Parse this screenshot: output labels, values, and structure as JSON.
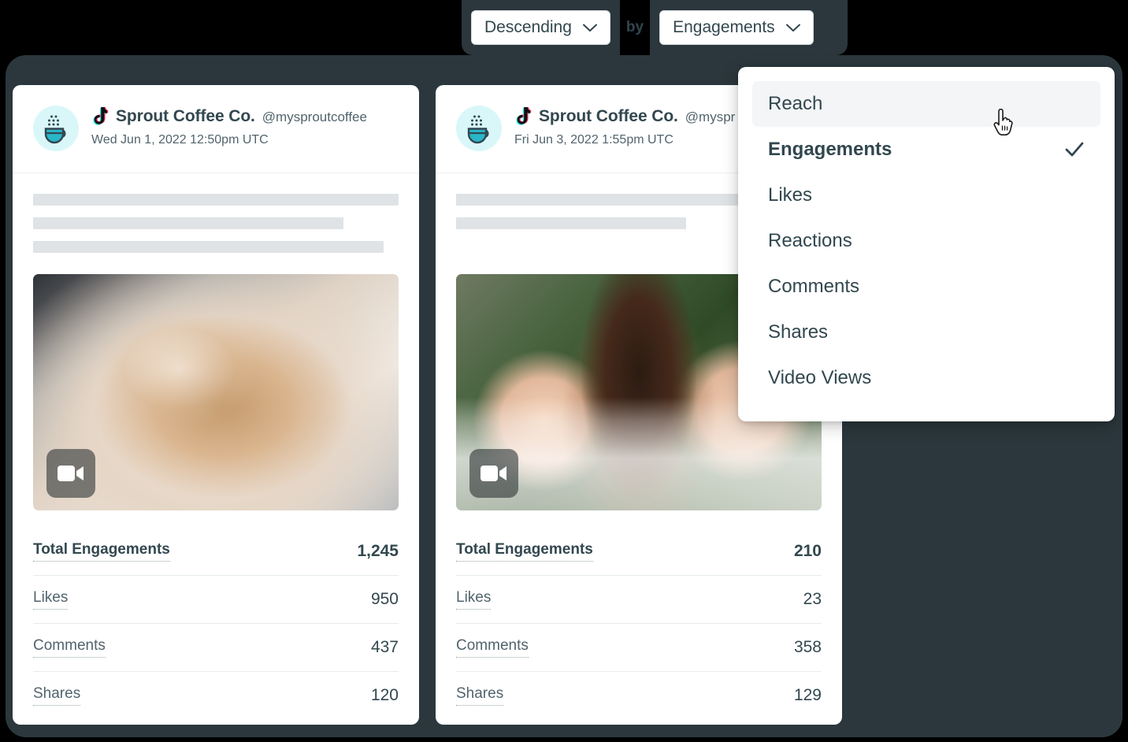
{
  "sort_bar": {
    "direction": {
      "value": "Descending",
      "icon": "chevron-down-icon"
    },
    "conjunction": "by",
    "metric": {
      "value": "Engagements",
      "icon": "chevron-down-icon"
    }
  },
  "dropdown": {
    "items": [
      {
        "label": "Reach",
        "selected": false,
        "hovered": true
      },
      {
        "label": "Engagements",
        "selected": true,
        "hovered": false
      },
      {
        "label": "Likes",
        "selected": false,
        "hovered": false
      },
      {
        "label": "Reactions",
        "selected": false,
        "hovered": false
      },
      {
        "label": "Comments",
        "selected": false,
        "hovered": false
      },
      {
        "label": "Shares",
        "selected": false,
        "hovered": false
      },
      {
        "label": "Video Views",
        "selected": false,
        "hovered": false
      }
    ]
  },
  "cards": [
    {
      "account_name": "Sprout Coffee Co.",
      "handle": "@mysproutcoffee",
      "date": "Wed Jun 1, 2022 12:50pm UTC",
      "network_icon": "tiktok-icon",
      "avatar_icon": "coffee-cup-icon",
      "media_badge_icon": "video-camera-icon",
      "media_alt": "iced latte in clear plastic cup",
      "metrics": [
        {
          "label": "Total Engagements",
          "value": "1,245",
          "total": true
        },
        {
          "label": "Likes",
          "value": "950",
          "total": false
        },
        {
          "label": "Comments",
          "value": "437",
          "total": false
        },
        {
          "label": "Shares",
          "value": "120",
          "total": false
        }
      ]
    },
    {
      "account_name": "Sprout Coffee Co.",
      "handle": "@myspr",
      "date": "Fri Jun 3, 2022 1:55pm UTC",
      "network_icon": "tiktok-icon",
      "avatar_icon": "coffee-cup-icon",
      "media_badge_icon": "video-camera-icon",
      "media_alt": "hand holding iced coffee with milk",
      "metrics": [
        {
          "label": "Total Engagements",
          "value": "210",
          "total": true
        },
        {
          "label": "Likes",
          "value": "23",
          "total": false
        },
        {
          "label": "Comments",
          "value": "358",
          "total": false
        },
        {
          "label": "Shares",
          "value": "129",
          "total": false
        }
      ]
    }
  ],
  "colors": {
    "panel_dark": "#2b373c",
    "text_primary": "#32474f",
    "text_secondary": "#51646c",
    "avatar_bg": "#d9f7f9",
    "accent_cyan": "#29b6c8",
    "skeleton": "#dfe3e5",
    "hover_bg": "#f3f5f6"
  },
  "cursor": {
    "type": "pointer-hand-cursor"
  }
}
